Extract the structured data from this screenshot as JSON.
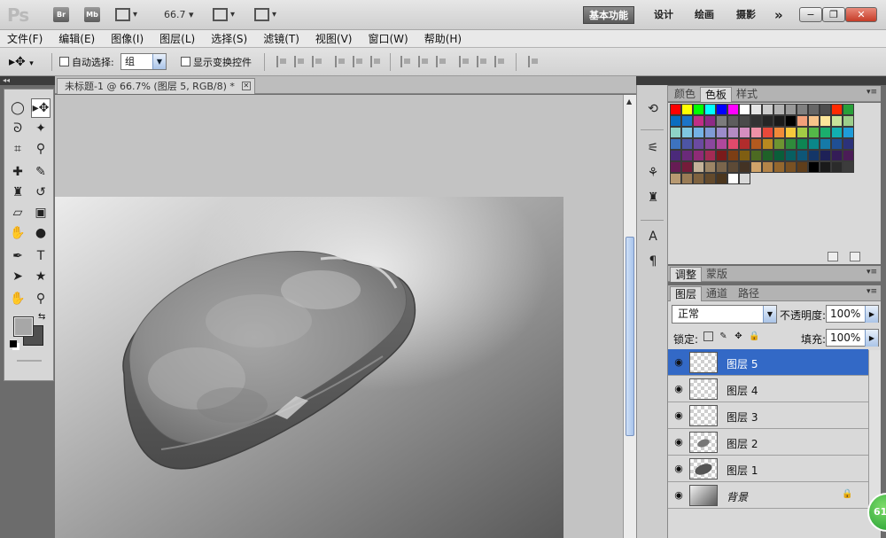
{
  "app": {
    "logo": "Ps",
    "bridge_btn": "Br",
    "minibridge_btn": "Mb",
    "zoom": "66.7",
    "workspaces": [
      "基本功能",
      "设计",
      "绘画",
      "摄影"
    ],
    "more": "»"
  },
  "menu": [
    "文件(F)",
    "编辑(E)",
    "图像(I)",
    "图层(L)",
    "选择(S)",
    "滤镜(T)",
    "视图(V)",
    "窗口(W)",
    "帮助(H)"
  ],
  "options": {
    "auto_select_label": "自动选择:",
    "auto_select_value": "组",
    "show_transform_label": "显示变换控件"
  },
  "document": {
    "tab_title": "未标题-1 @ 66.7% (图层 5, RGB/8) *"
  },
  "panels": {
    "color_tabs": [
      "颜色",
      "色板",
      "样式"
    ],
    "active_color_tab": "色板",
    "adjust_tabs": [
      "调整",
      "蒙版"
    ],
    "layer_tabs": [
      "图层",
      "通道",
      "路径"
    ],
    "blend_mode": "正常",
    "opacity_label": "不透明度:",
    "opacity": "100%",
    "lock_label": "锁定:",
    "fill_label": "填充:",
    "fill": "100%",
    "layers": [
      {
        "name": "图层 5",
        "selected": true,
        "thumb": "empty"
      },
      {
        "name": "图层 4",
        "selected": false,
        "thumb": "empty"
      },
      {
        "name": "图层 3",
        "selected": false,
        "thumb": "empty"
      },
      {
        "name": "图层 2",
        "selected": false,
        "thumb": "shape-small"
      },
      {
        "name": "图层 1",
        "selected": false,
        "thumb": "shape"
      },
      {
        "name": "背景",
        "selected": false,
        "thumb": "gradient",
        "locked": true
      }
    ]
  },
  "swatch_colors": [
    "#ff0000",
    "#ffff00",
    "#00ff00",
    "#00ffff",
    "#0000ff",
    "#ff00ff",
    "#ffffff",
    "#e6e6e6",
    "#cccccc",
    "#b3b3b3",
    "#999999",
    "#808080",
    "#666666",
    "#4d4d4d",
    "#ff2a00",
    "#29a03a",
    "#0a6dbf",
    "#1b74c7",
    "#c02e86",
    "#8e2a86",
    "#7c7c7c",
    "#5d5d5d",
    "#4a4a4a",
    "#333333",
    "#262626",
    "#1a1a1a",
    "#000000",
    "#f2a07a",
    "#f7c48a",
    "#fde69a",
    "#c7e29a",
    "#9ccf8a",
    "#8ed3c6",
    "#7fc7e0",
    "#74b2e4",
    "#7f9bd6",
    "#9c8cca",
    "#b48bc2",
    "#d48ebf",
    "#ee91a6",
    "#e8493a",
    "#ef8a39",
    "#f6c83c",
    "#a2cc45",
    "#54b848",
    "#1bae6d",
    "#12afb0",
    "#1f9cd8",
    "#3d73bf",
    "#4d55a5",
    "#6b4aa1",
    "#8b479e",
    "#b0489c",
    "#e04a6c",
    "#b12c2c",
    "#b35a1f",
    "#b8891f",
    "#6d9431",
    "#2f8a3b",
    "#0d8553",
    "#0b8789",
    "#157aa8",
    "#1f4f94",
    "#2c327a",
    "#4b2a7a",
    "#6a2a7a",
    "#8f2b77",
    "#a32b54",
    "#7a1b1b",
    "#7c3e14",
    "#7f5e12",
    "#4c6a22",
    "#1f6128",
    "#0a5e3a",
    "#085f61",
    "#0e5677",
    "#143668",
    "#1e2157",
    "#341c57",
    "#4b1c57",
    "#661c54",
    "#741c3a",
    "#c4b39a",
    "#9c8566",
    "#7a654c",
    "#5d4a36",
    "#433324",
    "#d0a46a",
    "#b38448",
    "#94672e",
    "#795123",
    "#5f3e1b",
    "#000000",
    "#1a1a1a",
    "#2b2b2b",
    "#3c3c3c",
    "#b89a72",
    "#9a7c56",
    "#7e623f",
    "#634a2c",
    "#4b361e",
    "#ffffff",
    "#d8d8d8"
  ]
}
